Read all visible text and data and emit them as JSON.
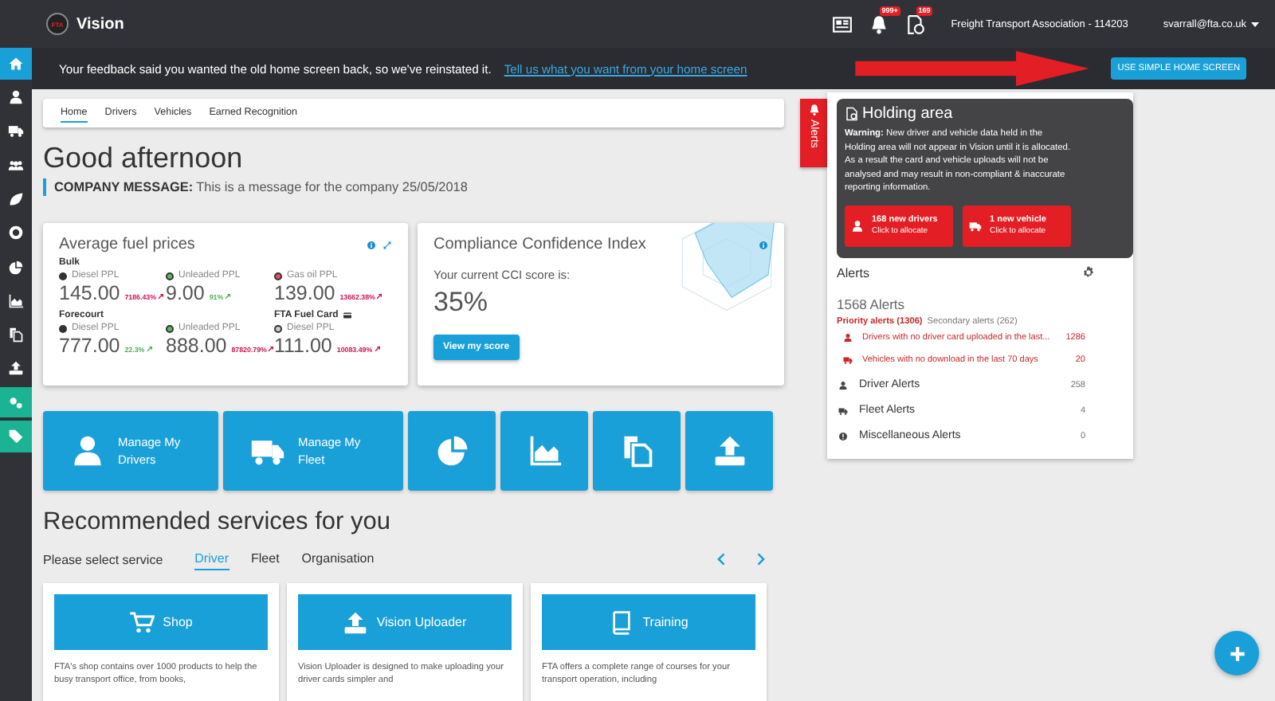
{
  "header": {
    "logo_text": "FTA",
    "app_name": "Vision",
    "notifications_badge": "999+",
    "tasks_badge": "169",
    "organisation": "Freight Transport Association - 114203",
    "user": "svarrall@fta.co.uk"
  },
  "banner": {
    "message": "Your feedback said you wanted the old home screen back, so we've reinstated it.",
    "link": "Tell us what you want from your home screen",
    "button": "USE SIMPLE HOME SCREEN"
  },
  "sidebar": {
    "items": [
      {
        "selected": true,
        "accent": false
      },
      {
        "selected": false,
        "accent": false
      },
      {
        "selected": false,
        "accent": false
      },
      {
        "selected": false,
        "accent": false
      },
      {
        "selected": false,
        "accent": false
      },
      {
        "selected": false,
        "accent": false
      },
      {
        "selected": false,
        "accent": false
      },
      {
        "selected": false,
        "accent": false
      },
      {
        "selected": false,
        "accent": false
      },
      {
        "selected": false,
        "accent": false
      },
      {
        "selected": false,
        "accent": true
      },
      {
        "selected": false,
        "accent": true
      }
    ]
  },
  "nav_tabs": [
    {
      "label": "Home",
      "selected": true
    },
    {
      "label": "Drivers",
      "selected": false
    },
    {
      "label": "Vehicles",
      "selected": false
    },
    {
      "label": "Earned Recognition",
      "selected": false
    }
  ],
  "greeting": "Good afternoon",
  "company_message": "**COMPANY MESSAGE:** This is a message for the company 25/05/2018",
  "fuel_card": {
    "title": "Average fuel prices",
    "rows": [
      {
        "cells": [
          {
            "heading": "Bulk",
            "name": "Diesel PPL",
            "color": "#333333",
            "value": "145.00",
            "change": {
              "text": "7186.43%",
              "color": "#d0104c"
            }
          },
          {
            "name": "Unleaded PPL",
            "color": "#5cb85c",
            "value": "9.00",
            "change": {
              "text": "91%",
              "color": "#4caf50"
            }
          },
          {
            "name": "Gas oil PPL",
            "color": "#e0506a",
            "value": "139.00",
            "change": {
              "text": "13662.38%",
              "color": "#d0104c"
            }
          }
        ]
      },
      {
        "cells": [
          {
            "heading": "Forecourt",
            "name": "Diesel PPL",
            "color": "#333333",
            "value": "777.00",
            "change": {
              "text": "22.3%",
              "color": "#4caf50"
            }
          },
          {
            "name": "Unleaded PPL",
            "color": "#5cb85c",
            "value": "888.00",
            "change": {
              "text": "87820.79%",
              "color": "#d0104c"
            }
          },
          {
            "heading": "FTA Fuel Card",
            "name": "Diesel PPL",
            "color": "#cccccc",
            "value": "111.00",
            "change": {
              "text": "10083.49%",
              "color": "#d0104c"
            }
          }
        ]
      }
    ]
  },
  "cci": {
    "title": "Compliance Confidence Index",
    "label": "Your current CCI score is:",
    "score": "35%",
    "button": "View my score"
  },
  "tiles": [
    {
      "kind": "labeled",
      "label": "Manage My Drivers"
    },
    {
      "kind": "labeled",
      "label": "Manage My Fleet"
    },
    {
      "kind": "icon"
    },
    {
      "kind": "icon"
    },
    {
      "kind": "icon"
    },
    {
      "kind": "icon"
    }
  ],
  "recommended": {
    "title": "Recommended services for you",
    "prompt": "Please select service",
    "tabs": [
      {
        "label": "Driver",
        "selected": true
      },
      {
        "label": "Fleet",
        "selected": false
      },
      {
        "label": "Organisation",
        "selected": false
      }
    ],
    "cards": [
      {
        "title": "Shop",
        "description": "FTA's shop contains over 1000 products to help the busy transport office, from books,"
      },
      {
        "title": "Vision Uploader",
        "description": "Vision Uploader is designed to make uploading your driver cards simpler and"
      },
      {
        "title": "Training",
        "description": "FTA offers a complete range of courses for your transport operation, including"
      }
    ]
  },
  "alerts_tab": "Alerts",
  "holding_area": {
    "title": "Holding area",
    "warning": "**Warning:** New driver and vehicle data held in the Holding area will not appear in Vision until it is allocated. As a result the card and vehicle uploads will not be analysed and may result in non-compliant & inaccurate reporting information.",
    "actions": [
      {
        "title": "168 new drivers",
        "subtitle": "Click to allocate"
      },
      {
        "title": "1 new vehicle",
        "subtitle": "Click to allocate"
      }
    ]
  },
  "alerts": {
    "title": "Alerts",
    "total": "1568 Alerts",
    "priority": "Priority alerts (1306)",
    "secondary": "Secondary alerts (262)",
    "priority_items": [
      {
        "text": "Drivers with no driver card uploaded in the last...",
        "count": "1286"
      },
      {
        "text": "Vehicles with no download in the last 70 days",
        "count": "20"
      }
    ],
    "categories": [
      {
        "label": "Driver Alerts",
        "count": "258"
      },
      {
        "label": "Fleet Alerts",
        "count": "4"
      },
      {
        "label": "Miscellaneous Alerts",
        "count": "0"
      }
    ]
  }
}
